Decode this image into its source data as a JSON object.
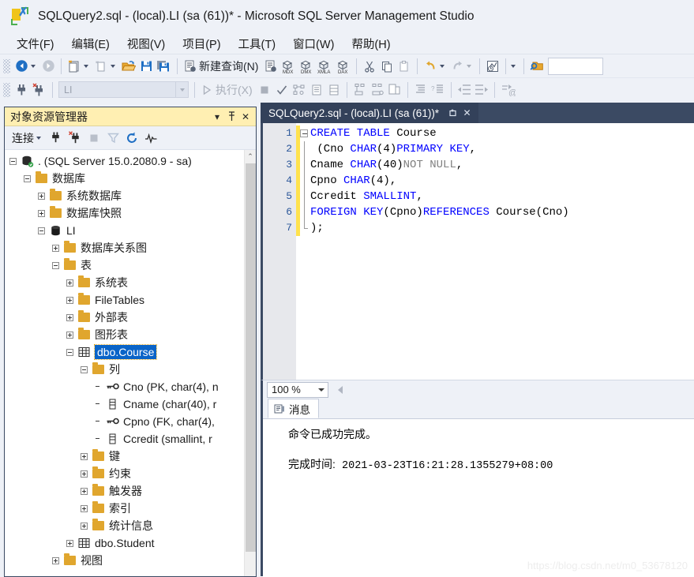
{
  "window": {
    "title": "SQLQuery2.sql - (local).LI (sa (61))* - Microsoft SQL Server Management Studio",
    "logo_icon": "ssms-logo-icon"
  },
  "menubar": {
    "items": [
      {
        "label": "文件(F)",
        "name": "menu-file"
      },
      {
        "label": "编辑(E)",
        "name": "menu-edit"
      },
      {
        "label": "视图(V)",
        "name": "menu-view"
      },
      {
        "label": "项目(P)",
        "name": "menu-project"
      },
      {
        "label": "工具(T)",
        "name": "menu-tools"
      },
      {
        "label": "窗口(W)",
        "name": "menu-window"
      },
      {
        "label": "帮助(H)",
        "name": "menu-help"
      }
    ]
  },
  "toolbar_main": {
    "new_query_label": "新建查询(N)",
    "items": [
      "navigate-back-icon",
      "navigate-forward-icon",
      "new-project-icon",
      "new-item-icon",
      "open-file-icon",
      "save-icon",
      "save-all-icon",
      "new-query-icon",
      "new-analysis-query-icon",
      "new-mdx-query-icon",
      "new-dmx-query-icon",
      "new-xmla-query-icon",
      "new-dax-query-icon",
      "cut-icon",
      "copy-icon",
      "paste-icon",
      "undo-icon",
      "redo-icon",
      "window-layout-icon",
      "find-folder-icon"
    ]
  },
  "toolbar_editor": {
    "execute_label": "执行(X)",
    "database_value": "LI",
    "items": [
      "connect-icon",
      "disconnect-icon",
      "execute-icon",
      "stop-icon",
      "parse-icon",
      "display-estimated-plan-icon",
      "query-options-icon",
      "include-actual-plan-icon",
      "include-client-statistics-icon",
      "results-to-text-icon",
      "results-to-grid-icon",
      "results-to-file-icon",
      "comment-icon",
      "uncomment-icon",
      "decrease-indent-icon",
      "increase-indent-icon",
      "specify-values-icon"
    ]
  },
  "object_explorer": {
    "title": "对象资源管理器",
    "title_buttons": [
      {
        "name": "window-position-chevron-icon",
        "glyph": "▾"
      },
      {
        "name": "pin-icon",
        "glyph": "⇱"
      },
      {
        "name": "close-icon",
        "glyph": "✕"
      }
    ],
    "connect_label": "连接",
    "toolbar_icons": [
      "connect-object-explorer-icon",
      "disconnect-object-explorer-icon",
      "stop-icon",
      "filter-icon",
      "refresh-icon",
      "activity-monitor-icon"
    ],
    "tree": [
      {
        "label": ". (SQL Server 15.0.2080.9 - sa)",
        "indent": 0,
        "state": "minus",
        "icon": "server-icon",
        "selected": false
      },
      {
        "label": "数据库",
        "indent": 1,
        "state": "minus",
        "icon": "folder-icon",
        "selected": false
      },
      {
        "label": "系统数据库",
        "indent": 2,
        "state": "plus",
        "icon": "folder-icon",
        "selected": false
      },
      {
        "label": "数据库快照",
        "indent": 2,
        "state": "plus",
        "icon": "folder-icon",
        "selected": false
      },
      {
        "label": "LI",
        "indent": 2,
        "state": "minus",
        "icon": "database-icon",
        "selected": false
      },
      {
        "label": "数据库关系图",
        "indent": 3,
        "state": "plus",
        "icon": "folder-icon",
        "selected": false
      },
      {
        "label": "表",
        "indent": 3,
        "state": "minus",
        "icon": "folder-icon",
        "selected": false
      },
      {
        "label": "系统表",
        "indent": 4,
        "state": "plus",
        "icon": "folder-icon",
        "selected": false
      },
      {
        "label": "FileTables",
        "indent": 4,
        "state": "plus",
        "icon": "folder-icon",
        "selected": false
      },
      {
        "label": "外部表",
        "indent": 4,
        "state": "plus",
        "icon": "folder-icon",
        "selected": false
      },
      {
        "label": "图形表",
        "indent": 4,
        "state": "plus",
        "icon": "folder-icon",
        "selected": false
      },
      {
        "label": "dbo.Course",
        "indent": 4,
        "state": "minus",
        "icon": "table-icon",
        "selected": true
      },
      {
        "label": "列",
        "indent": 5,
        "state": "minus",
        "icon": "folder-icon",
        "selected": false
      },
      {
        "label": "Cno (PK, char(4), n",
        "indent": 6,
        "state": "none",
        "icon": "primary-key-column-icon",
        "selected": false
      },
      {
        "label": "Cname (char(40), r",
        "indent": 6,
        "state": "none",
        "icon": "column-icon",
        "selected": false
      },
      {
        "label": "Cpno (FK, char(4),",
        "indent": 6,
        "state": "none",
        "icon": "foreign-key-column-icon",
        "selected": false
      },
      {
        "label": "Ccredit (smallint, r",
        "indent": 6,
        "state": "none",
        "icon": "column-icon",
        "selected": false
      },
      {
        "label": "键",
        "indent": 5,
        "state": "plus",
        "icon": "folder-icon",
        "selected": false
      },
      {
        "label": "约束",
        "indent": 5,
        "state": "plus",
        "icon": "folder-icon",
        "selected": false
      },
      {
        "label": "触发器",
        "indent": 5,
        "state": "plus",
        "icon": "folder-icon",
        "selected": false
      },
      {
        "label": "索引",
        "indent": 5,
        "state": "plus",
        "icon": "folder-icon",
        "selected": false
      },
      {
        "label": "统计信息",
        "indent": 5,
        "state": "plus",
        "icon": "folder-icon",
        "selected": false
      },
      {
        "label": "dbo.Student",
        "indent": 4,
        "state": "plus",
        "icon": "table-icon",
        "selected": false
      },
      {
        "label": "视图",
        "indent": 3,
        "state": "plus",
        "icon": "folder-icon",
        "selected": false
      }
    ]
  },
  "editor": {
    "tab_label": "SQLQuery2.sql - (local).LI (sa (61))*",
    "tab_buttons": [
      {
        "name": "tab-float-icon",
        "glyph": "⇲"
      },
      {
        "name": "tab-close-icon",
        "glyph": "✕"
      }
    ],
    "line_numbers": [
      "1",
      "2",
      "3",
      "4",
      "5",
      "6",
      "7"
    ],
    "code_lines": [
      {
        "n": "1",
        "fold": "start",
        "tokens": [
          {
            "t": "CREATE TABLE",
            "c": "kw"
          },
          {
            "t": " Course",
            "c": "plain"
          }
        ]
      },
      {
        "n": "2",
        "fold": "mid",
        "tokens": [
          {
            "t": " (Cno ",
            "c": "plain"
          },
          {
            "t": "CHAR",
            "c": "dt"
          },
          {
            "t": "(4)",
            "c": "plain"
          },
          {
            "t": "PRIMARY KEY",
            "c": "kw"
          },
          {
            "t": ",",
            "c": "plain"
          }
        ]
      },
      {
        "n": "3",
        "fold": "mid",
        "tokens": [
          {
            "t": "Cname ",
            "c": "plain"
          },
          {
            "t": "CHAR",
            "c": "dt"
          },
          {
            "t": "(40)",
            "c": "plain"
          },
          {
            "t": "NOT NULL",
            "c": "gray"
          },
          {
            "t": ",",
            "c": "plain"
          }
        ]
      },
      {
        "n": "4",
        "fold": "mid",
        "tokens": [
          {
            "t": "Cpno ",
            "c": "plain"
          },
          {
            "t": "CHAR",
            "c": "dt"
          },
          {
            "t": "(4),",
            "c": "plain"
          }
        ]
      },
      {
        "n": "5",
        "fold": "mid",
        "tokens": [
          {
            "t": "Ccredit ",
            "c": "plain"
          },
          {
            "t": "SMALLINT",
            "c": "dt"
          },
          {
            "t": ",",
            "c": "plain"
          }
        ]
      },
      {
        "n": "6",
        "fold": "mid",
        "tokens": [
          {
            "t": "FOREIGN KEY",
            "c": "kw"
          },
          {
            "t": "(Cpno)",
            "c": "plain"
          },
          {
            "t": "REFERENCES",
            "c": "kw"
          },
          {
            "t": " Course(Cno)",
            "c": "plain"
          }
        ]
      },
      {
        "n": "7",
        "fold": "end",
        "tokens": [
          {
            "t": ");",
            "c": "plain"
          }
        ]
      }
    ],
    "zoom_value": "100 %"
  },
  "results": {
    "tab_label": "消息",
    "tab_icon": "messages-icon",
    "lines": [
      "命令已成功完成。",
      "",
      "完成时间: 2021-03-23T16:21:28.1355279+08:00"
    ],
    "success_message": "命令已成功完成。",
    "completion_label": "完成时间:",
    "completion_time": "2021-03-23T16:21:28.1355279+08:00"
  },
  "watermark": {
    "text": "https://blog.csdn.net/m0_53678120"
  },
  "colors": {
    "title_bg": "#eef1f7",
    "oe_title_bg": "#ffefb2",
    "tab_active_bg": "#33415a",
    "tabstrip_bg": "#3b4a63",
    "selection_blue": "#0a64c8",
    "keyword_blue": "#0000ff",
    "comment_gray": "#808080",
    "folder_orange": "#e0a62e",
    "changebar_yellow": "#ffe24d"
  }
}
